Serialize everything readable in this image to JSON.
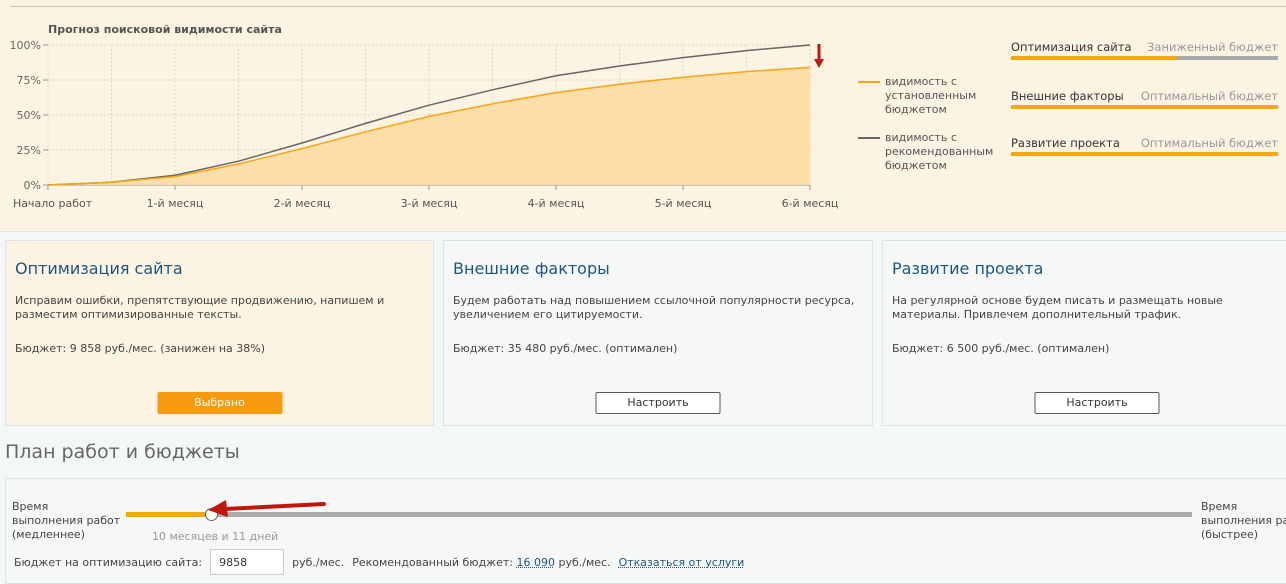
{
  "chart_data": {
    "type": "area",
    "title": "Прогноз поисковой видимости сайта",
    "categories": [
      "Начало работ",
      "1-й месяц",
      "2-й месяц",
      "3-й месяц",
      "4-й месяц",
      "5-й месяц",
      "6-й месяц"
    ],
    "yticks": [
      "0%",
      "25%",
      "50%",
      "75%",
      "100%"
    ],
    "ylim": [
      0,
      100
    ],
    "x": [
      0,
      0.5,
      1,
      1.5,
      2,
      2.5,
      3,
      3.5,
      4,
      4.5,
      5,
      5.5,
      6
    ],
    "series": [
      {
        "name": "видимость с установленным бюджетом",
        "color": "#f3a712",
        "values": [
          0,
          2,
          6,
          15,
          26,
          38,
          49,
          58,
          66,
          72,
          77,
          81,
          84
        ]
      },
      {
        "name": "видимость с рекомендованным бюджетом",
        "color": "#666666",
        "values": [
          0,
          2,
          7,
          17,
          30,
          44,
          57,
          68,
          78,
          85,
          91,
          96,
          100
        ]
      }
    ]
  },
  "legend": [
    {
      "label": "видимость с установленным бюджетом",
      "color": "#f3a712"
    },
    {
      "label": "видимость с рекомендованным бюджетом",
      "color": "#666666"
    }
  ],
  "budgets": [
    {
      "name": "Оптимизация сайта",
      "status": "Заниженный бюджет",
      "fill": 0.62
    },
    {
      "name": "Внешние факторы",
      "status": "Оптимальный бюджет",
      "fill": 1
    },
    {
      "name": "Развитие проекта",
      "status": "Оптимальный бюджет",
      "fill": 1
    }
  ],
  "cards": [
    {
      "title": "Оптимизация сайта",
      "text": "Исправим ошибки, препятствующие продвижению, напишем и разместим оптимизированные тексты.",
      "budget": "Бюджет: 9 858 руб./мес. (занижен на 38%)",
      "button": "Выбрано"
    },
    {
      "title": "Внешние факторы",
      "text": "Будем работать над повышением ссылочной популярности ресурса, увеличением его цитируемости.",
      "budget": "Бюджет: 35 480 руб./мес. (оптимален)",
      "button": "Настроить"
    },
    {
      "title": "Развитие проекта",
      "text": "На регулярной основе будем писать и размещать новые материалы. Привлечем дополнительный трафик.",
      "budget": "Бюджет: 6 500 руб./мес. (оптимален)",
      "button": "Настроить"
    }
  ],
  "plan": {
    "title": "План работ и бюджеты",
    "slow": "Время выполнения работ (медленнее)",
    "fast": "Время выполнения работ (быстрее)",
    "slider_fraction": 0.08,
    "duration": "10 месяцев и 11 дней",
    "budget_label": "Бюджет на оптимизацию сайта:",
    "budget_value": "9858",
    "unit": "руб./мес.",
    "recommended_label": "Рекомендованный бюджет:",
    "recommended_value": "16 090",
    "unit2": "руб./мес.",
    "decline": "Отказаться от услуги"
  }
}
